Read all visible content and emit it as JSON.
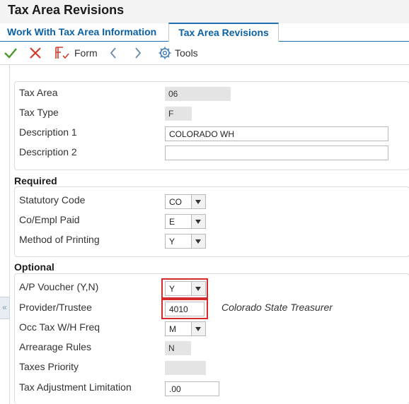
{
  "header": {
    "title": "Tax Area Revisions"
  },
  "tabs": [
    {
      "label": "Work With Tax Area Information"
    },
    {
      "label": "Tax Area Revisions"
    }
  ],
  "toolbar": {
    "form_label": "Form",
    "tools_label": "Tools",
    "icons": [
      "checkmark-icon",
      "close-icon",
      "form-icon",
      "chevron-left-icon",
      "chevron-right-icon",
      "gear-icon"
    ],
    "accent_ok": "#4a9a2e",
    "accent_cancel": "#d33a2a"
  },
  "top_section": {
    "tax_area": {
      "label": "Tax Area",
      "value": "06"
    },
    "tax_type": {
      "label": "Tax Type",
      "value": "F"
    },
    "description1": {
      "label": "Description 1",
      "value": "COLORADO WH"
    },
    "description2": {
      "label": "Description 2",
      "value": ""
    }
  },
  "required": {
    "heading": "Required",
    "statutory_code": {
      "label": "Statutory Code",
      "value": "CO"
    },
    "co_empl_paid": {
      "label": "Co/Empl Paid",
      "value": "E"
    },
    "method_of_printing": {
      "label": "Method of Printing",
      "value": "Y"
    }
  },
  "optional": {
    "heading": "Optional",
    "ap_voucher": {
      "label": "A/P Voucher (Y,N)",
      "value": "Y"
    },
    "provider_trustee": {
      "label": "Provider/Trustee",
      "value": "4010",
      "description": "Colorado State Treasurer"
    },
    "occ_tax_freq": {
      "label": "Occ Tax W/H Freq",
      "value": "M"
    },
    "arrearage_rules": {
      "label": "Arrearage Rules",
      "value": "N"
    },
    "taxes_priority": {
      "label": "Taxes Priority",
      "value": ""
    },
    "tax_adjustment_limitation": {
      "label": "Tax Adjustment Limitation",
      "value": ".00"
    }
  },
  "side_handle": {
    "glyph": "«"
  },
  "highlight_color": "#d62b2b"
}
